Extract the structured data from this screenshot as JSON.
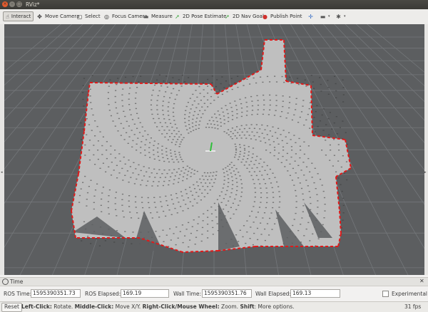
{
  "window": {
    "title": "RViz*",
    "close_glyph": "×",
    "min_glyph": "–",
    "max_glyph": "□"
  },
  "toolbar": {
    "tools": [
      {
        "label": "Interact",
        "icon": "hand-cursor-icon",
        "glyph": "☝",
        "color": "#3c3c3c",
        "active": true
      },
      {
        "label": "Move Camera",
        "icon": "move-camera-icon",
        "glyph": "✥",
        "color": "#3c3c3c",
        "active": false
      },
      {
        "label": "Select",
        "icon": "select-icon",
        "glyph": "▢",
        "color": "#3c3c3c",
        "active": false
      },
      {
        "label": "Focus Camera",
        "icon": "focus-camera-icon",
        "glyph": "◎",
        "color": "#3c3c3c",
        "active": false
      },
      {
        "label": "Measure",
        "icon": "ruler-icon",
        "glyph": "▬",
        "color": "#555555",
        "active": false
      },
      {
        "label": "2D Pose Estimate",
        "icon": "pose-estimate-arrow-icon",
        "glyph": "➚",
        "color": "#3aa53a",
        "active": false
      },
      {
        "label": "2D Nav Goal",
        "icon": "nav-goal-arrow-icon",
        "glyph": "➚",
        "color": "#3aa53a",
        "active": false
      },
      {
        "label": "Publish Point",
        "icon": "map-pin-icon",
        "glyph": "●",
        "color": "#d0312d",
        "active": false
      }
    ],
    "extras": [
      {
        "name": "add-tool-icon",
        "glyph": "✛",
        "color": "#3a6fc6"
      },
      {
        "name": "remove-tool-icon",
        "glyph": "▬",
        "color": "#555555"
      },
      {
        "name": "view-options-icon",
        "glyph": "✱",
        "color": "#555555"
      }
    ],
    "caret": "▾"
  },
  "time_panel": {
    "title": "Time",
    "close_glyph": "✕",
    "ros_time_label": "ROS Time:",
    "ros_time": "1595390351.73",
    "ros_elapsed_label": "ROS Elapsed:",
    "ros_elapsed": "169.19",
    "wall_time_label": "Wall Time:",
    "wall_time": "1595390351.76",
    "wall_elapsed_label": "Wall Elapsed:",
    "wall_elapsed": "169.13",
    "experimental_label": "Experimental",
    "experimental_checked": false
  },
  "status_bar": {
    "reset_label": "Reset",
    "hint_parts": [
      {
        "text": "Left-Click:",
        "bold": true
      },
      {
        "text": " Rotate. ",
        "bold": false
      },
      {
        "text": "Middle-Click:",
        "bold": true
      },
      {
        "text": " Move X/Y. ",
        "bold": false
      },
      {
        "text": "Right-Click/Mouse Wheel:",
        "bold": true
      },
      {
        "text": " Zoom. ",
        "bold": false
      },
      {
        "text": "Shift",
        "bold": true
      },
      {
        "text": ": More options.",
        "bold": false
      }
    ],
    "fps": "31 fps"
  },
  "viewport": {
    "background": "#5c5e60",
    "grid_color": "#74777a",
    "free_space_color": "#bfbfbf",
    "occupied_color": "#3a3a3a",
    "laser_color": "#e01a1a",
    "axis_x_color": "#e8e8e8",
    "axis_y_color": "#2fbf3a"
  }
}
